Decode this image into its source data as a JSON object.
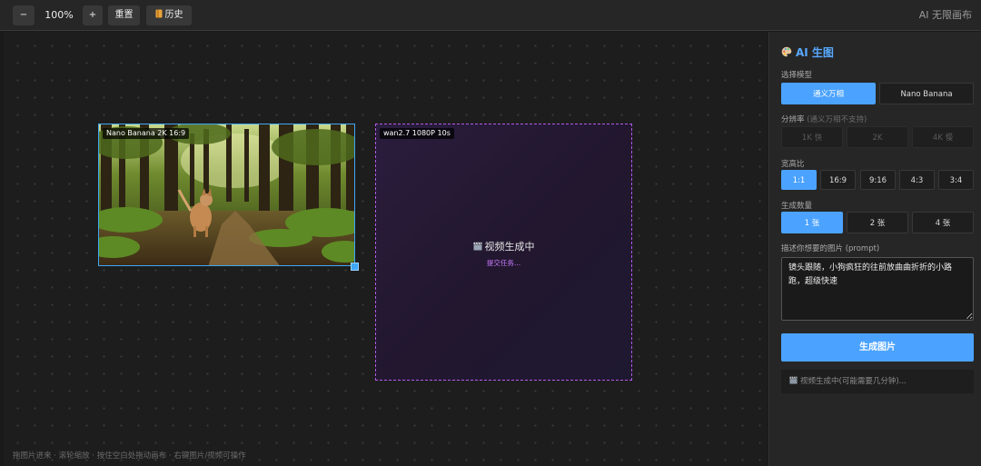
{
  "toolbar": {
    "zoom_out": "−",
    "zoom_level": "100%",
    "zoom_in": "+",
    "reset": "重置",
    "history": "历史",
    "history_icon": "bookmark-icon",
    "app_title": "AI 无限画布"
  },
  "canvas": {
    "image_node": {
      "tag": "Nano Banana 2K 16:9",
      "image": "forest-dog-photo"
    },
    "video_node": {
      "tag": "wan2.7 1080P 10s",
      "status": "视频生成中",
      "status_icon": "clapperboard-icon",
      "sub_status": "提交任务..."
    },
    "hint": "拖图片进来 · 滚轮缩放 · 按住空白处拖动画布 · 右键图片/视频可操作"
  },
  "panel": {
    "title": "AI 生图",
    "title_icon": "palette-icon",
    "model": {
      "label": "选择模型",
      "options": [
        "通义万相",
        "Nano Banana"
      ],
      "selected": "通义万相"
    },
    "resolution": {
      "label": "分辨率",
      "note": "(通义万相不支持)",
      "options": [
        "1K 快",
        "2K",
        "4K 慢"
      ]
    },
    "aspect": {
      "label": "宽高比",
      "options": [
        "1:1",
        "16:9",
        "9:16",
        "4:3",
        "3:4"
      ],
      "selected": "1:1"
    },
    "count": {
      "label": "生成数量",
      "options": [
        "1 张",
        "2 张",
        "4 张"
      ],
      "selected": "1 张"
    },
    "prompt": {
      "label": "描述你想要的图片 (prompt)",
      "value": "镜头跟随，小狗疯狂的往前放曲曲折折的小路跑，超级快速"
    },
    "generate_button": "生成图片",
    "status": "视频生成中(可能需要几分钟)...",
    "status_icon": "clapperboard-icon"
  },
  "colors": {
    "accent": "#4ba3ff",
    "selection": "#3fa7f5",
    "video_border": "#b25ae8"
  }
}
